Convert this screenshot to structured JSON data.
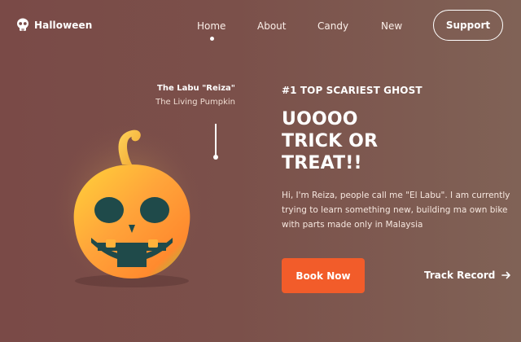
{
  "brand": {
    "name": "Halloween",
    "icon": "skull-icon"
  },
  "nav": {
    "links": [
      "Home",
      "About",
      "Candy",
      "New"
    ],
    "active_index": 0,
    "support_label": "Support"
  },
  "character": {
    "name": "The Labu \"Reiza\"",
    "subtitle": "The Living Pumpkin"
  },
  "hero": {
    "eyebrow": "#1 TOP SCARIEST GHOST",
    "headline_lines": [
      "UOOOO",
      "TRICK OR",
      "TREAT!!"
    ],
    "description": "Hi, I'm Reiza, people call me \"El Labu\". I am currently trying to learn something new, building ma own bike with parts made only in Malaysia",
    "primary_cta": "Book Now",
    "secondary_cta": "Track Record",
    "secondary_icon": "arrow-right-icon"
  },
  "colors": {
    "background": "#7b4d49",
    "accent": "#f25c2a",
    "text": "#ffffff"
  }
}
